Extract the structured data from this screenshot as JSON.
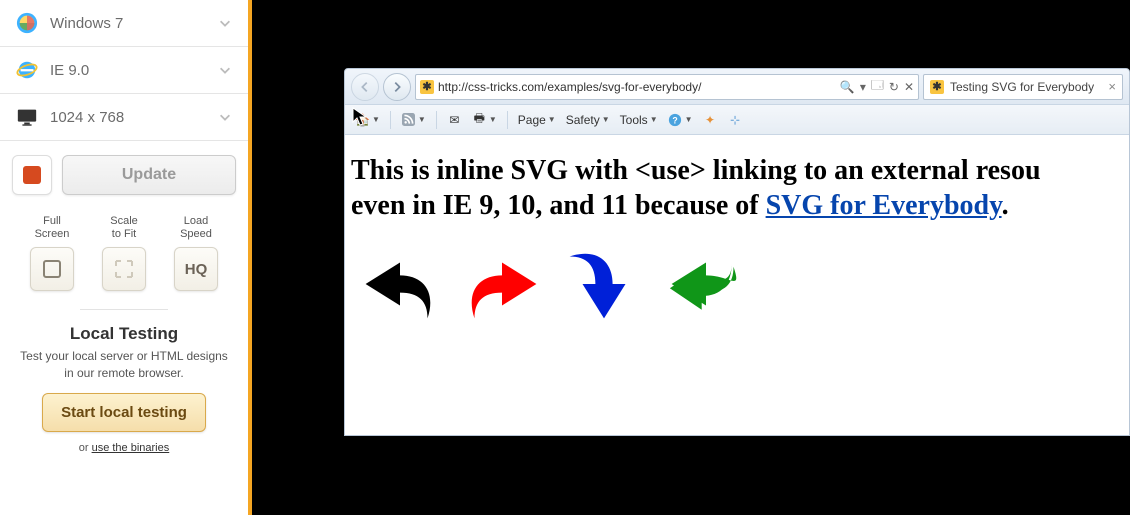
{
  "sidebar": {
    "os": {
      "label": "Windows 7"
    },
    "browser": {
      "label": "IE 9.0"
    },
    "resolution": {
      "label": "1024 x 768"
    },
    "update_label": "Update",
    "tools": {
      "fullscreen": "Full\nScreen",
      "scale": "Scale\nto Fit",
      "speed": "Load\nSpeed",
      "hq_label": "HQ"
    },
    "local": {
      "title": "Local Testing",
      "subtitle": "Test your local server or HTML designs in our remote browser.",
      "button": "Start local testing",
      "or": "or ",
      "link": "use the binaries"
    }
  },
  "ie": {
    "url": "http://css-tricks.com/examples/svg-for-everybody/",
    "addr_icons": {
      "search": "🔍",
      "dropdown": "▾",
      "refresh": "↻",
      "stop": "✕",
      "new": "🗔"
    },
    "tab_title": "Testing SVG for Everybody",
    "toolbar": {
      "page": "Page",
      "safety": "Safety",
      "tools": "Tools"
    },
    "page": {
      "heading_pre": "This is inline SVG with <use> linking to an external resou",
      "heading_line2_pre": "even in IE 9, 10, and 11 because of ",
      "heading_link": "SVG for Everybody",
      "heading_post": "."
    },
    "arrows": [
      {
        "name": "undo",
        "color": "#000000"
      },
      {
        "name": "redo",
        "color": "#ff0000"
      },
      {
        "name": "down-curve",
        "color": "#0020d8"
      },
      {
        "name": "left-curve",
        "color": "#109618"
      }
    ]
  }
}
